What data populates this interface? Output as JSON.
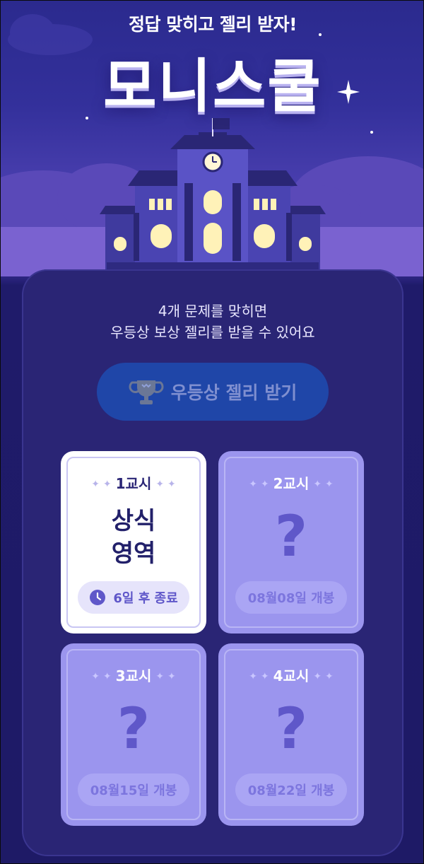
{
  "hero": {
    "tagline": "정답 맞히고 젤리 받자!",
    "logo": "모니스쿨"
  },
  "panel": {
    "description_line1": "4개 문제를 맞히면",
    "description_line2": "우등상 보상 젤리를 받을 수 있어요",
    "claim_button_label": "우등상 젤리 받기",
    "claim_icon": "trophy-icon"
  },
  "cards": [
    {
      "period": "1교시",
      "subject_line1": "상식",
      "subject_line2": "영역",
      "status": "6일 후 종료",
      "status_icon": "clock-icon",
      "locked": false
    },
    {
      "period": "2교시",
      "placeholder": "?",
      "status": "08월08일 개봉",
      "locked": true
    },
    {
      "period": "3교시",
      "placeholder": "?",
      "status": "08월15일 개봉",
      "locked": true
    },
    {
      "period": "4교시",
      "placeholder": "?",
      "status": "08월22일 개봉",
      "locked": true
    }
  ],
  "colors": {
    "background": "#1e1a66",
    "panel": "#2a2575",
    "button": "#1f46a8",
    "locked_card": "#9b95ee",
    "accent": "#5f57c9"
  }
}
